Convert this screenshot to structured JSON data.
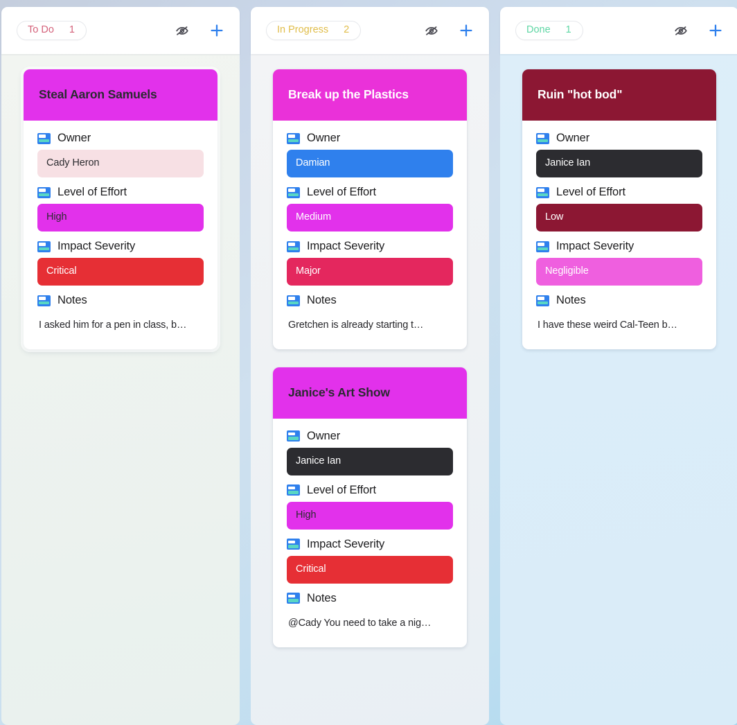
{
  "board": {
    "type": "kanban",
    "field_icon": "single-select-field-icon",
    "columns": [
      {
        "status_label": "To Do",
        "count": "1",
        "status_color": "#d4617a",
        "hide_icon": "eye-off-icon",
        "add_icon": "plus-icon",
        "body_bg": "#eef3ef",
        "cards": [
          {
            "title": "Steal Aaron Samuels",
            "selected": true,
            "header_bg": "#e231eb",
            "header_text_color": "#2a2a30",
            "fields": [
              {
                "label": "Owner",
                "value": "Cady Heron",
                "chip_bg": "#f7e0e4",
                "chip_text": "#2b2b2f"
              },
              {
                "label": "Level of Effort",
                "value": "High",
                "chip_bg": "#e231eb",
                "chip_text": "#2b2b2f"
              },
              {
                "label": "Impact Severity",
                "value": "Critical",
                "chip_bg": "#e62f35",
                "chip_text": "#ffffff"
              }
            ],
            "notes_label": "Notes",
            "notes_value": "I asked him for a pen in class, b…"
          }
        ]
      },
      {
        "status_label": "In Progress",
        "count": "2",
        "status_color": "#e0bd4a",
        "hide_icon": "eye-off-icon",
        "add_icon": "plus-icon",
        "body_bg": "#eff2f4",
        "cards": [
          {
            "title": "Break up the Plastics",
            "selected": false,
            "header_bg": "#ea31d9",
            "header_text_color": "#ffffff",
            "fields": [
              {
                "label": "Owner",
                "value": "Damian",
                "chip_bg": "#2f80ed",
                "chip_text": "#ffffff"
              },
              {
                "label": "Level of Effort",
                "value": "Medium",
                "chip_bg": "#e231eb",
                "chip_text": "#ffffff"
              },
              {
                "label": "Impact Severity",
                "value": "Major",
                "chip_bg": "#e4275e",
                "chip_text": "#ffffff"
              }
            ],
            "notes_label": "Notes",
            "notes_value": "Gretchen is already starting t…"
          },
          {
            "title": "Janice's Art Show",
            "selected": false,
            "header_bg": "#e231eb",
            "header_text_color": "#2a2a30",
            "fields": [
              {
                "label": "Owner",
                "value": "Janice Ian",
                "chip_bg": "#2c2c30",
                "chip_text": "#ffffff"
              },
              {
                "label": "Level of Effort",
                "value": "High",
                "chip_bg": "#e231eb",
                "chip_text": "#2b2b2f"
              },
              {
                "label": "Impact Severity",
                "value": "Critical",
                "chip_bg": "#e62f35",
                "chip_text": "#ffffff"
              }
            ],
            "notes_label": "Notes",
            "notes_value": "@Cady You need to take a nig…"
          }
        ]
      },
      {
        "status_label": "Done",
        "count": "1",
        "status_color": "#5ed6a4",
        "hide_icon": "eye-off-icon",
        "add_icon": "plus-icon",
        "body_bg": "#dbedf9",
        "cards": [
          {
            "title": "Ruin \"hot bod\"",
            "selected": false,
            "header_bg": "#8c1733",
            "header_text_color": "#ffffff",
            "fields": [
              {
                "label": "Owner",
                "value": "Janice Ian",
                "chip_bg": "#2c2c30",
                "chip_text": "#ffffff"
              },
              {
                "label": "Level of Effort",
                "value": "Low",
                "chip_bg": "#8c1733",
                "chip_text": "#ffffff"
              },
              {
                "label": "Impact Severity",
                "value": "Negligible",
                "chip_bg": "#ef5fdf",
                "chip_text": "#ffffff"
              }
            ],
            "notes_label": "Notes",
            "notes_value": "I have these weird Cal-Teen b…"
          }
        ]
      }
    ]
  },
  "theme": {
    "page_bg_start": "#c5cedd",
    "page_bg_end": "#a8d6ee",
    "add_icon_color": "#2f80ed",
    "hide_icon_color": "#4a4a52"
  }
}
